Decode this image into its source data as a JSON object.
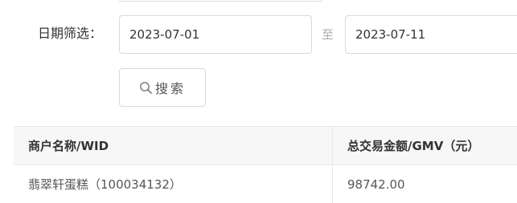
{
  "filter": {
    "label": "日期筛选：",
    "start_date": "2023-07-01",
    "separator": "至",
    "end_date": "2023-07-11",
    "search_label": "搜索"
  },
  "table": {
    "headers": [
      "商户名称/WID",
      "总交易金额/GMV（元）"
    ],
    "rows": [
      [
        "翡翠轩蛋糕（100034132）",
        "98742.00"
      ]
    ]
  }
}
